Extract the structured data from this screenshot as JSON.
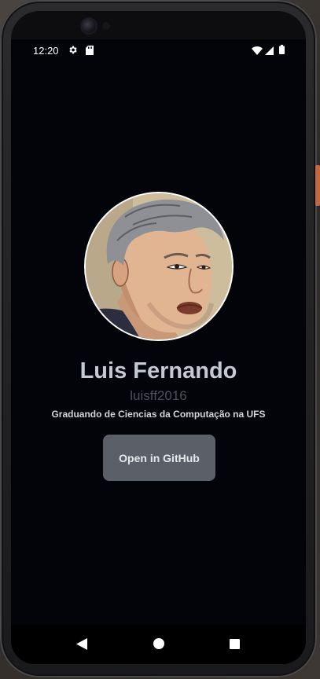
{
  "status_bar": {
    "time": "12:20",
    "icons": [
      "gear-icon",
      "sd-card-icon",
      "wifi-icon",
      "signal-icon",
      "battery-icon"
    ]
  },
  "profile": {
    "name": "Luis Fernando",
    "username": "luisff2016",
    "bio": "Graduando de Ciencias da Computação na UFS",
    "avatar": "avatar-illustration"
  },
  "actions": {
    "open_github_label": "Open in GitHub"
  },
  "nav_bar": {
    "icons": [
      "back-icon",
      "home-icon",
      "recents-icon"
    ]
  },
  "colors": {
    "background": "#020409",
    "name_text": "#c5cad1",
    "username_text": "#4d5259",
    "button_bg": "#5b6068",
    "accent_side_button": "#c2673e"
  }
}
